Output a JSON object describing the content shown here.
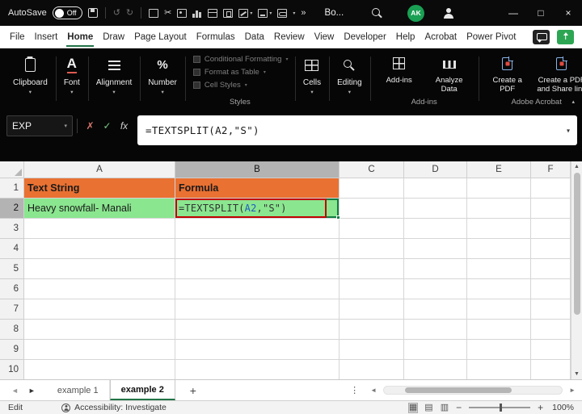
{
  "colors": {
    "accent_green": "#217346",
    "orange_fill": "#E97132",
    "green_fill": "#8AE68F",
    "ref_blue": "#1F5AC2",
    "annotation_red": "#C00000",
    "active_cell_green": "#107C41",
    "avatar_green": "#1AA053"
  },
  "icons": {
    "chevron_down": "▾",
    "chevron_up": "▴",
    "undo": "↺",
    "redo": "↻",
    "cut": "✂",
    "cancel": "✗",
    "enter": "✓",
    "fx": "fx",
    "more": "»",
    "kebab": "⋮",
    "left_arrow": "◄",
    "right_arrow": "►",
    "up_arrow": "▲",
    "down_arrow": "▼",
    "minimize": "—",
    "maximize": "□",
    "close": "×",
    "plus": "+",
    "minus": "−",
    "font": "A",
    "number": "%",
    "view_normal": "▦",
    "view_layout": "▤",
    "view_break": "▥"
  },
  "titlebar": {
    "autosave_label": "AutoSave",
    "autosave_state": "Off",
    "workbook_title": "Bo...",
    "avatar_initials": "AK"
  },
  "menubar": {
    "items": [
      "File",
      "Insert",
      "Home",
      "Draw",
      "Page Layout",
      "Formulas",
      "Data",
      "Review",
      "View",
      "Developer",
      "Help",
      "Acrobat",
      "Power Pivot"
    ],
    "active": "Home"
  },
  "ribbon": {
    "collapsed_groups": [
      {
        "id": "clipboard",
        "label": "Clipboard"
      },
      {
        "id": "font",
        "label": "Font"
      },
      {
        "id": "alignment",
        "label": "Alignment"
      },
      {
        "id": "number",
        "label": "Number"
      }
    ],
    "styles_group": {
      "items": [
        "Conditional Formatting",
        "Format as Table",
        "Cell Styles"
      ],
      "label": "Styles"
    },
    "cells_group": {
      "label": "Cells"
    },
    "editing_group": {
      "label": "Editing"
    },
    "addins_group": {
      "buttons": [
        "Add-ins",
        "Analyze Data"
      ],
      "label": "Add-ins"
    },
    "acrobat_group": {
      "buttons": [
        "Create a PDF",
        "Create a PDF and Share link"
      ],
      "label": "Adobe Acrobat"
    }
  },
  "formula_bar": {
    "name_box": "EXP",
    "formula": "=TEXTSPLIT(A2,\"S\")"
  },
  "grid": {
    "columns": [
      "A",
      "B",
      "C",
      "D",
      "E",
      "F"
    ],
    "row_count": 10,
    "selected_column": "B",
    "selected_row": 2,
    "cells": [
      {
        "ref": "A1",
        "text": "Text String",
        "fill": "#E97132",
        "bold": true
      },
      {
        "ref": "B1",
        "text": "Formula",
        "fill": "#E97132",
        "bold": true
      },
      {
        "ref": "A2",
        "text": "Heavy snowfall- Manali",
        "fill": "#8AE68F"
      },
      {
        "ref": "B2",
        "fill": "#8AE68F",
        "active": true,
        "annotation": true,
        "formula_parts": [
          {
            "t": "=TEXTSPLIT(",
            "c": "plain"
          },
          {
            "t": "A2",
            "c": "ref"
          },
          {
            "t": ",\"S\")",
            "c": "plain"
          }
        ]
      }
    ]
  },
  "sheet_tabs": {
    "tabs": [
      "example 1",
      "example 2"
    ],
    "active": "example 2"
  },
  "statusbar": {
    "mode": "Edit",
    "accessibility": "Accessibility: Investigate",
    "zoom": "100%"
  }
}
